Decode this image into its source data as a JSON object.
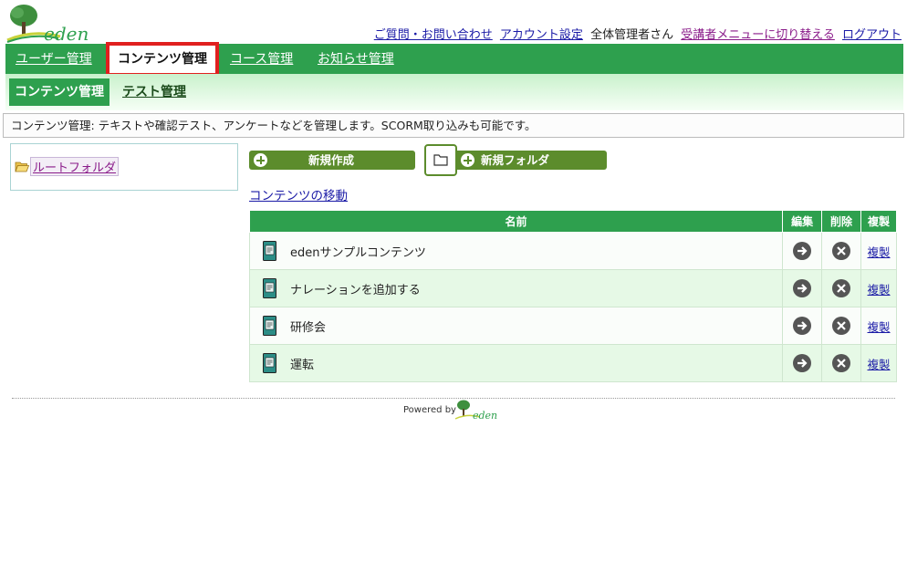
{
  "brand": {
    "logo_text": "eden",
    "footer_powered": "Powered by",
    "footer_logo_text": "eden"
  },
  "toplinks": {
    "contact": "ご質問・お問い合わせ",
    "account": "アカウント設定",
    "user": "全体管理者さん",
    "switch_menu": "受講者メニューに切り替える",
    "logout": "ログアウト"
  },
  "mainnav": {
    "items": [
      {
        "label": "ユーザー管理"
      },
      {
        "label": "コンテンツ管理"
      },
      {
        "label": "コース管理"
      },
      {
        "label": "お知らせ管理"
      }
    ],
    "active_index": 1
  },
  "subnav": {
    "active": "コンテンツ管理",
    "other": "テスト管理"
  },
  "description": "コンテンツ管理: テキストや確認テスト、アンケートなどを管理します。SCORM取り込みも可能です。",
  "tree": {
    "root_label": "ルートフォルダ"
  },
  "actions": {
    "new_create": "新規作成",
    "new_folder": "新規フォルダ",
    "move_contents": "コンテンツの移動"
  },
  "table": {
    "headers": {
      "name": "名前",
      "edit": "編集",
      "delete": "削除",
      "copy": "複製"
    },
    "rows": [
      {
        "name": "edenサンプルコンテンツ",
        "copy": "複製"
      },
      {
        "name": "ナレーションを追加する",
        "copy": "複製"
      },
      {
        "name": "研修会",
        "copy": "複製"
      },
      {
        "name": "運転",
        "copy": "複製"
      }
    ]
  },
  "colors": {
    "nav_green": "#2ea04e",
    "button_green": "#5c8c2c",
    "highlight_red": "#e0201f",
    "row_alt": "#e6f9e6"
  }
}
